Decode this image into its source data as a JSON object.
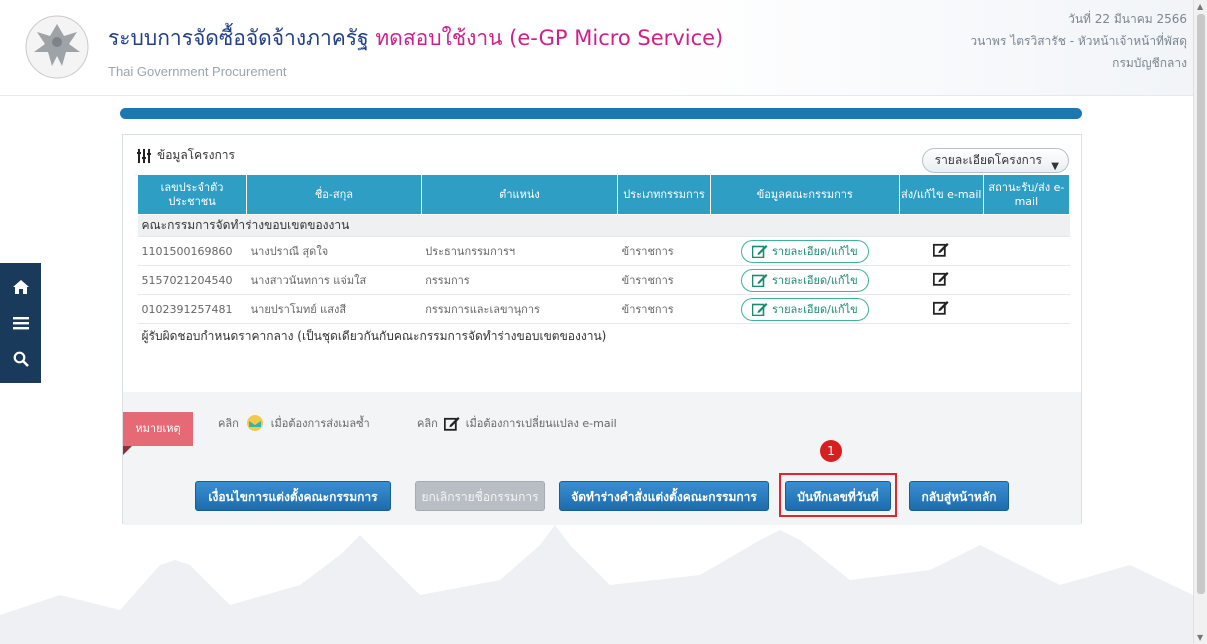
{
  "header": {
    "title_main": "ระบบการจัดซื้อจัดจ้างภาครัฐ ",
    "title_trial": "ทดสอบใช้งาน (e-GP Micro Service)",
    "subtitle": "Thai Government Procurement",
    "date": "วันที่ 22 มีนาคม 2566",
    "user": "วนาพร ไตรวิสารัช - หัวหน้าเจ้าหน้าที่พัสดุ",
    "department": "กรมบัญชีกลาง"
  },
  "panel": {
    "title": "ข้อมูลโครงการ",
    "detail_button": "รายละเอียดโครงการ",
    "columns": [
      "เลขประจำตัวประชาชน",
      "ชื่อ-สกุล",
      "ตำแหน่ง",
      "ประเภทกรรมการ",
      "ข้อมูลคณะกรรมการ",
      "ส่ง/แก้ไข e-mail",
      "สถานะรับ/ส่ง e-mail"
    ],
    "section1": "คณะกรรมการจัดทำร่างขอบเขตของงาน",
    "rows": [
      {
        "id": "1101500169860",
        "name": "นางปราณี สุดใจ",
        "position": "ประธานกรรมการฯ",
        "type": "ข้าราชการ",
        "action": "รายละเอียด/แก้ไข"
      },
      {
        "id": "5157021204540",
        "name": "นางสาวนันทการ แจ่มใส",
        "position": "กรรมการ",
        "type": "ข้าราชการ",
        "action": "รายละเอียด/แก้ไข"
      },
      {
        "id": "0102391257481",
        "name": "นายปราโมทย์ แสงสี",
        "position": "กรรมการและเลขานุการ",
        "type": "ข้าราชการ",
        "action": "รายละเอียด/แก้ไข"
      }
    ],
    "section2": "ผู้รับผิดชอบกำหนดราคากลาง (เป็นชุดเดียวกันกับคณะกรรมการจัดทำร่างขอบเขตของงาน)"
  },
  "notes": {
    "tag": "หมายเหตุ",
    "click1": "คลิก",
    "text1": "เมื่อต้องการส่งเมลซ้ำ",
    "click2": "คลิก",
    "text2": "เมื่อต้องการเปลี่ยนแปลง e-mail"
  },
  "buttons": {
    "amend": "เงื่อนไขการแต่งตั้งคณะกรรมการ",
    "cancel": "ยกเลิกรายชื่อกรรมการ",
    "draft": "จัดทำร่างคำสั่งแต่งตั้งคณะกรรมการ",
    "save_number": "บันทึกเลขที่วันที่",
    "home": "กลับสู่หน้าหลัก"
  },
  "annotation": {
    "step": "1"
  },
  "colors": {
    "header_blue": "#1f3f86",
    "trial_pink": "#d01f8a",
    "table_head": "#2f9ec4",
    "button_blue": "#1c6cae",
    "highlight": "#e0262b"
  }
}
